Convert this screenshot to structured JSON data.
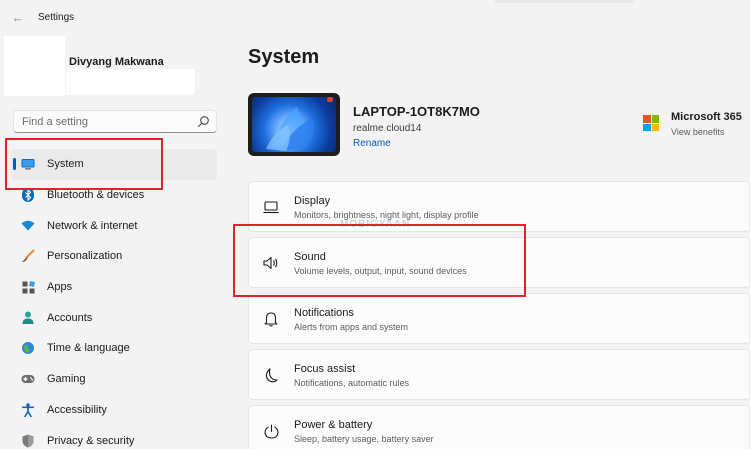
{
  "window": {
    "title": "Settings",
    "back_glyph": "←"
  },
  "user": {
    "name": "Divyang Makwana"
  },
  "search": {
    "placeholder": "Find a setting"
  },
  "nav": {
    "items": [
      {
        "label": "System",
        "icon": "monitor-icon",
        "active": true
      },
      {
        "label": "Bluetooth & devices",
        "icon": "bluetooth-icon"
      },
      {
        "label": "Network & internet",
        "icon": "wifi-icon"
      },
      {
        "label": "Personalization",
        "icon": "brush-icon"
      },
      {
        "label": "Apps",
        "icon": "apps-icon"
      },
      {
        "label": "Accounts",
        "icon": "person-icon"
      },
      {
        "label": "Time & language",
        "icon": "globe-icon"
      },
      {
        "label": "Gaming",
        "icon": "gamepad-icon"
      },
      {
        "label": "Accessibility",
        "icon": "accessibility-icon"
      },
      {
        "label": "Privacy & security",
        "icon": "shield-icon"
      }
    ]
  },
  "main": {
    "title": "System",
    "device": {
      "name": "LAPTOP-1OT8K7MO",
      "model": "realme cloud14",
      "rename_label": "Rename"
    },
    "promo": {
      "title": "Microsoft 365",
      "subtitle": "View benefits"
    },
    "cards": [
      {
        "title": "Display",
        "subtitle": "Monitors, brightness, night light, display profile",
        "icon": "display-icon"
      },
      {
        "title": "Sound",
        "subtitle": "Volume levels, output, input, sound devices",
        "icon": "speaker-icon"
      },
      {
        "title": "Notifications",
        "subtitle": "Alerts from apps and system",
        "icon": "bell-icon"
      },
      {
        "title": "Focus assist",
        "subtitle": "Notifications, automatic rules",
        "icon": "moon-icon"
      },
      {
        "title": "Power & battery",
        "subtitle": "Sleep, battery usage, battery saver",
        "icon": "power-icon"
      }
    ]
  },
  "watermark": {
    "text": "MOBIGYAAN"
  },
  "colors": {
    "accent": "#005fb8",
    "highlight": "#e0232b",
    "ms_logo": [
      "#f25022",
      "#7fba00",
      "#00a4ef",
      "#ffb900"
    ]
  }
}
